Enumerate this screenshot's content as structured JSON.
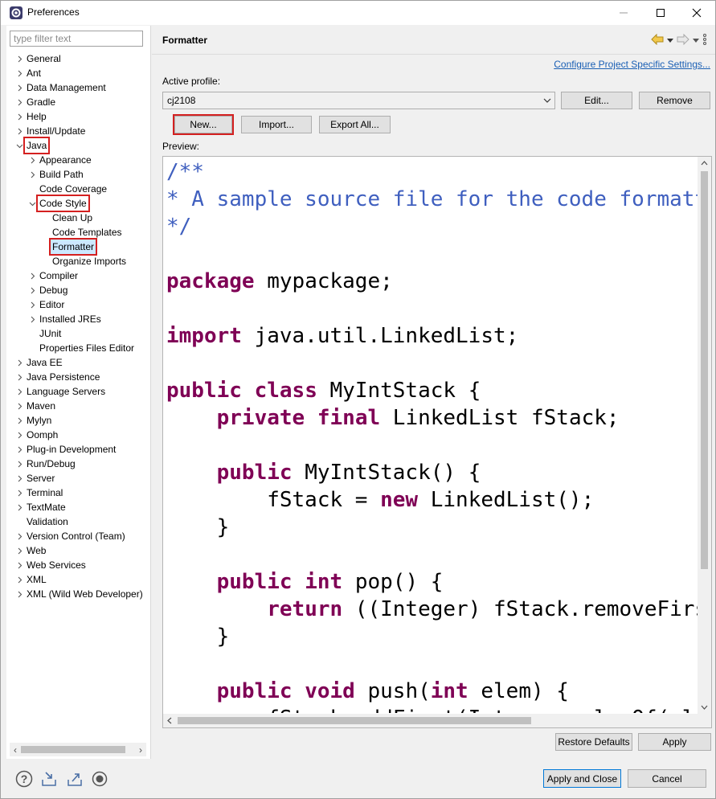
{
  "window": {
    "title": "Preferences",
    "accent": "#0078d7",
    "highlight_color": "#d42020"
  },
  "filter": {
    "placeholder": "type filter text",
    "value": ""
  },
  "tree": {
    "items": [
      {
        "label": "General",
        "level": 0,
        "expander": "collapsed"
      },
      {
        "label": "Ant",
        "level": 0,
        "expander": "collapsed"
      },
      {
        "label": "Data Management",
        "level": 0,
        "expander": "collapsed"
      },
      {
        "label": "Gradle",
        "level": 0,
        "expander": "collapsed"
      },
      {
        "label": "Help",
        "level": 0,
        "expander": "collapsed"
      },
      {
        "label": "Install/Update",
        "level": 0,
        "expander": "collapsed"
      },
      {
        "label": "Java",
        "level": 0,
        "expander": "expanded",
        "highlighted": true
      },
      {
        "label": "Appearance",
        "level": 1,
        "expander": "collapsed"
      },
      {
        "label": "Build Path",
        "level": 1,
        "expander": "collapsed"
      },
      {
        "label": "Code Coverage",
        "level": 1,
        "expander": "none"
      },
      {
        "label": "Code Style",
        "level": 1,
        "expander": "expanded",
        "highlighted": true
      },
      {
        "label": "Clean Up",
        "level": 2,
        "expander": "none"
      },
      {
        "label": "Code Templates",
        "level": 2,
        "expander": "none"
      },
      {
        "label": "Formatter",
        "level": 2,
        "expander": "none",
        "highlighted": true,
        "selected": true
      },
      {
        "label": "Organize Imports",
        "level": 2,
        "expander": "none"
      },
      {
        "label": "Compiler",
        "level": 1,
        "expander": "collapsed"
      },
      {
        "label": "Debug",
        "level": 1,
        "expander": "collapsed"
      },
      {
        "label": "Editor",
        "level": 1,
        "expander": "collapsed"
      },
      {
        "label": "Installed JREs",
        "level": 1,
        "expander": "collapsed"
      },
      {
        "label": "JUnit",
        "level": 1,
        "expander": "none"
      },
      {
        "label": "Properties Files Editor",
        "level": 1,
        "expander": "none"
      },
      {
        "label": "Java EE",
        "level": 0,
        "expander": "collapsed"
      },
      {
        "label": "Java Persistence",
        "level": 0,
        "expander": "collapsed"
      },
      {
        "label": "Language Servers",
        "level": 0,
        "expander": "collapsed"
      },
      {
        "label": "Maven",
        "level": 0,
        "expander": "collapsed"
      },
      {
        "label": "Mylyn",
        "level": 0,
        "expander": "collapsed"
      },
      {
        "label": "Oomph",
        "level": 0,
        "expander": "collapsed"
      },
      {
        "label": "Plug-in Development",
        "level": 0,
        "expander": "collapsed"
      },
      {
        "label": "Run/Debug",
        "level": 0,
        "expander": "collapsed"
      },
      {
        "label": "Server",
        "level": 0,
        "expander": "collapsed"
      },
      {
        "label": "Terminal",
        "level": 0,
        "expander": "collapsed"
      },
      {
        "label": "TextMate",
        "level": 0,
        "expander": "collapsed"
      },
      {
        "label": "Validation",
        "level": 0,
        "expander": "none"
      },
      {
        "label": "Version Control (Team)",
        "level": 0,
        "expander": "collapsed"
      },
      {
        "label": "Web",
        "level": 0,
        "expander": "collapsed"
      },
      {
        "label": "Web Services",
        "level": 0,
        "expander": "collapsed"
      },
      {
        "label": "XML",
        "level": 0,
        "expander": "collapsed"
      },
      {
        "label": "XML (Wild Web Developer)",
        "level": 0,
        "expander": "collapsed"
      }
    ]
  },
  "page": {
    "title": "Formatter",
    "configure_link": "Configure Project Specific Settings...",
    "active_profile_label": "Active profile:",
    "profile_value": "cj2108",
    "edit_label": "Edit...",
    "remove_label": "Remove",
    "new_label": "New...",
    "import_label": "Import...",
    "export_label": "Export All...",
    "preview_label": "Preview:"
  },
  "preview": {
    "lines": [
      [
        {
          "t": "/**",
          "c": "cmt"
        }
      ],
      [
        {
          "t": "* A sample source file for the code formatter preview",
          "c": "cmt"
        }
      ],
      [
        {
          "t": "*/",
          "c": "cmt"
        }
      ],
      [],
      [
        {
          "t": "package",
          "c": "kw"
        },
        {
          "t": " mypackage;",
          "c": ""
        }
      ],
      [],
      [
        {
          "t": "import",
          "c": "kw"
        },
        {
          "t": " java.util.LinkedList;",
          "c": ""
        }
      ],
      [],
      [
        {
          "t": "public",
          "c": "kw"
        },
        {
          "t": " ",
          "c": ""
        },
        {
          "t": "class",
          "c": "kw"
        },
        {
          "t": " MyIntStack {",
          "c": ""
        }
      ],
      [
        {
          "t": "    ",
          "c": ""
        },
        {
          "t": "private",
          "c": "kw"
        },
        {
          "t": " ",
          "c": ""
        },
        {
          "t": "final",
          "c": "kw"
        },
        {
          "t": " LinkedList fStack;",
          "c": ""
        }
      ],
      [],
      [
        {
          "t": "    ",
          "c": ""
        },
        {
          "t": "public",
          "c": "kw"
        },
        {
          "t": " MyIntStack() {",
          "c": ""
        }
      ],
      [
        {
          "t": "        fStack = ",
          "c": ""
        },
        {
          "t": "new",
          "c": "kw"
        },
        {
          "t": " LinkedList();",
          "c": ""
        }
      ],
      [
        {
          "t": "    }",
          "c": ""
        }
      ],
      [],
      [
        {
          "t": "    ",
          "c": ""
        },
        {
          "t": "public",
          "c": "kw"
        },
        {
          "t": " ",
          "c": ""
        },
        {
          "t": "int",
          "c": "kw"
        },
        {
          "t": " pop() {",
          "c": ""
        }
      ],
      [
        {
          "t": "        ",
          "c": ""
        },
        {
          "t": "return",
          "c": "kw"
        },
        {
          "t": " ((Integer) fStack.removeFirst()).intValue();",
          "c": ""
        }
      ],
      [
        {
          "t": "    }",
          "c": ""
        }
      ],
      [],
      [
        {
          "t": "    ",
          "c": ""
        },
        {
          "t": "public",
          "c": "kw"
        },
        {
          "t": " ",
          "c": ""
        },
        {
          "t": "void",
          "c": "kw"
        },
        {
          "t": " push(",
          "c": ""
        },
        {
          "t": "int",
          "c": "kw"
        },
        {
          "t": " elem) {",
          "c": ""
        }
      ],
      [
        {
          "t": "        fStack.addFirst(Integer.valueOf(elem));",
          "c": ""
        }
      ]
    ]
  },
  "buttons": {
    "restore_defaults": "Restore Defaults",
    "apply": "Apply",
    "apply_and_close": "Apply and Close",
    "cancel": "Cancel"
  },
  "bottom_icons": [
    "help-icon",
    "import-icon",
    "export-icon",
    "record-icon"
  ]
}
